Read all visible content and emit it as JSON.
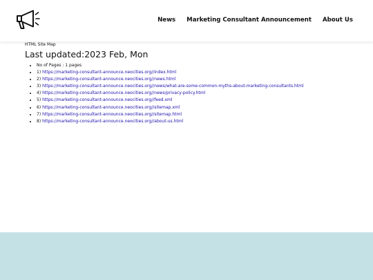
{
  "header": {
    "nav": [
      "News",
      "Marketing Consultant Announcement",
      "About Us"
    ]
  },
  "main": {
    "small_title": "HTML Site Map",
    "updated": "Last updated:2023 Feb, Mon",
    "pages_count": "No of Pages : 1 pages",
    "links": [
      {
        "num": "1)",
        "url": "https://marketing-consultant-announce.neocities.org//index.html"
      },
      {
        "num": "2)",
        "url": "https://marketing-consultant-announce.neocities.org//news.html"
      },
      {
        "num": "3)",
        "url": "https://marketing-consultant-announce.neocities.org//news/what-are-some-common-myths-about-marketing-consultants.html"
      },
      {
        "num": "4)",
        "url": "https://marketing-consultant-announce.neocities.org//news/privacy-policy.html"
      },
      {
        "num": "5)",
        "url": "https://marketing-consultant-announce.neocities.org//feed.xml"
      },
      {
        "num": "6)",
        "url": "https://marketing-consultant-announce.neocities.org//sitemap.xml"
      },
      {
        "num": "7)",
        "url": "https://marketing-consultant-announce.neocities.org//sitemap.html"
      },
      {
        "num": "8)",
        "url": "https://marketing-consultant-announce.neocities.org//about-us.html"
      }
    ]
  },
  "colors": {
    "link": "#1a0dab",
    "footer": "#c4e1e6"
  },
  "icons": {
    "logo": "megaphone-icon"
  }
}
